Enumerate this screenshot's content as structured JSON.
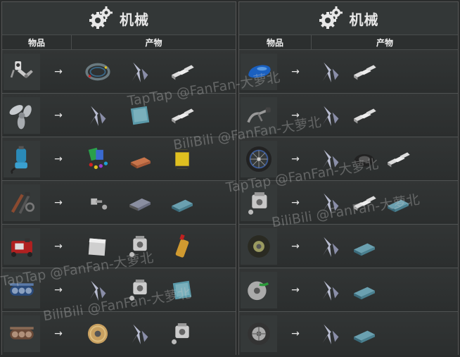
{
  "panels": [
    {
      "title": "机械",
      "col_item": "物品",
      "col_output": "产物",
      "rows": [
        {
          "item": "robot-arm-icon",
          "outputs": [
            "wire-coil-icon",
            "scrap-metal-icon",
            "iron-ingot-icon"
          ]
        },
        {
          "item": "propeller-icon",
          "outputs": [
            "scrap-metal-icon",
            "steel-plate-icon",
            "iron-ingot-icon"
          ]
        },
        {
          "item": "water-pump-icon",
          "outputs": [
            "wires-colorful-icon",
            "copper-ingot-icon",
            "oil-filter-icon"
          ]
        },
        {
          "item": "tools-icon",
          "outputs": [
            "bolts-icon",
            "iron-bar-icon",
            "steel-ingot-icon"
          ]
        },
        {
          "item": "generator-icon",
          "outputs": [
            "metal-sheet-icon",
            "engine-part-icon",
            "fuel-bottle-icon"
          ]
        },
        {
          "item": "tank-track-icon",
          "outputs": [
            "scrap-metal-icon",
            "engine-part-icon",
            "steel-plate-icon"
          ]
        },
        {
          "item": "tank-track-brown-icon",
          "outputs": [
            "copper-wire-spool-icon",
            "scrap-metal-icon",
            "engine-part-icon"
          ]
        }
      ]
    },
    {
      "title": "机械",
      "col_item": "物品",
      "col_output": "产物",
      "rows": [
        {
          "item": "fuel-tank-icon",
          "outputs": [
            "scrap-metal-icon",
            "iron-ingot-icon"
          ]
        },
        {
          "item": "handlebar-icon",
          "outputs": [
            "scrap-metal-icon",
            "iron-ingot-icon"
          ]
        },
        {
          "item": "bike-wheel-icon",
          "outputs": [
            "scrap-metal-icon",
            "rubber-icon",
            "iron-ingot-icon"
          ]
        },
        {
          "item": "engine-block-icon",
          "outputs": [
            "scrap-metal-icon",
            "iron-ingot-icon",
            "steel-ingot-icon"
          ]
        },
        {
          "item": "tire-icon",
          "outputs": [
            "scrap-metal-icon",
            "steel-ingot-icon"
          ]
        },
        {
          "item": "saw-blade-icon",
          "outputs": [
            "scrap-metal-icon",
            "steel-ingot-icon"
          ]
        },
        {
          "item": "wheel-rim-icon",
          "outputs": [
            "scrap-metal-icon",
            "steel-ingot-icon"
          ]
        }
      ]
    }
  ],
  "arrow": "→",
  "watermarks": [
    "TapTap @FanFan-大萝北",
    "BiliBili @FanFan-大萝北"
  ]
}
